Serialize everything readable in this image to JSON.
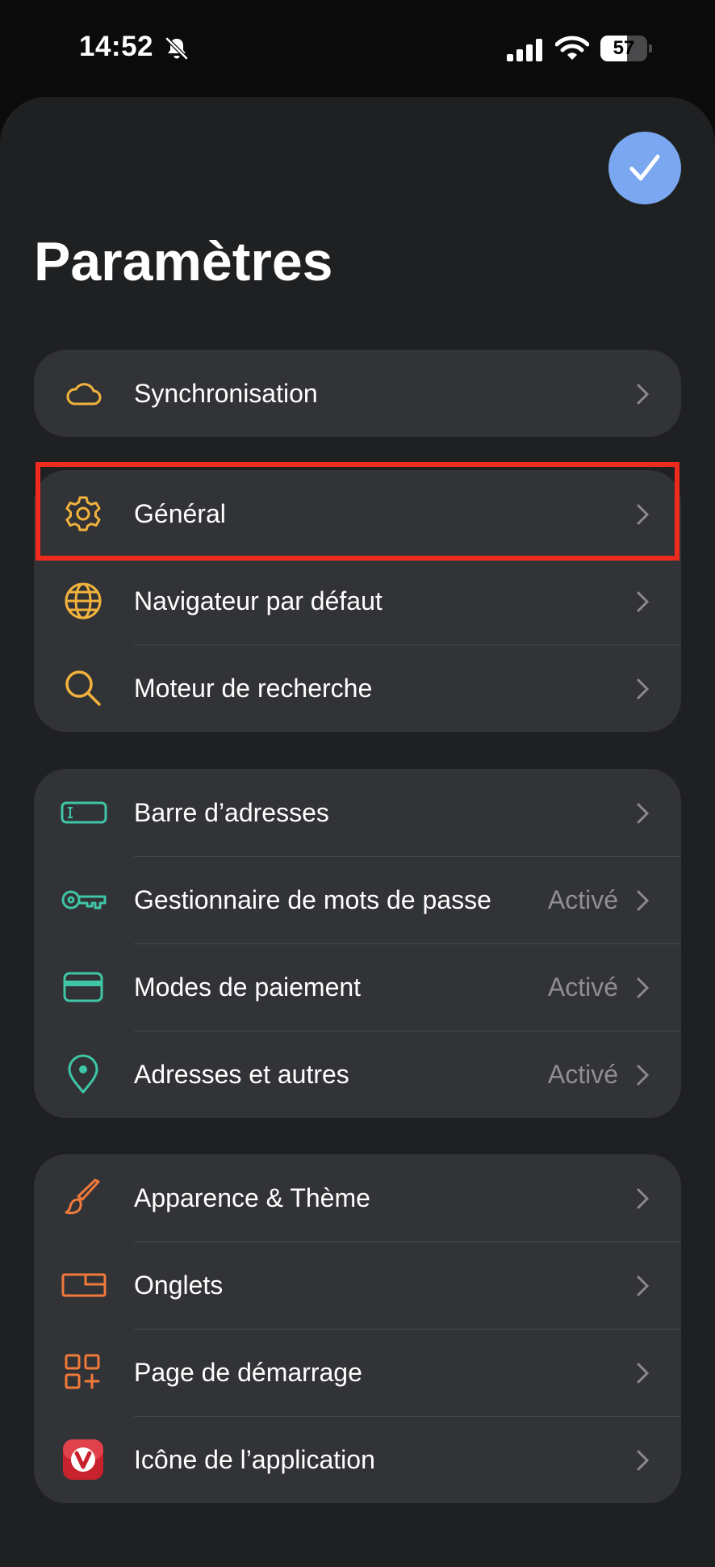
{
  "status_bar": {
    "time": "14:52",
    "battery": "57",
    "battery_level": 0.57
  },
  "header": {
    "title": "Paramètres"
  },
  "colors": {
    "yellow": "#f2b33d",
    "green": "#3fc6a6",
    "orange": "#f07a3a",
    "accent": "#7aa7f0",
    "highlight": "#ee2b1c"
  },
  "groups": [
    {
      "items": [
        {
          "label": "Synchronisation",
          "icon": "cloud-icon"
        }
      ]
    },
    {
      "items": [
        {
          "label": "Général",
          "icon": "gear-icon"
        },
        {
          "label": "Navigateur par défaut",
          "icon": "globe-icon"
        },
        {
          "label": "Moteur de recherche",
          "icon": "search-icon"
        }
      ]
    },
    {
      "items": [
        {
          "label": "Barre d’adresses",
          "icon": "address-bar-icon"
        },
        {
          "label": "Gestionnaire de mots de passe",
          "value": "Activé",
          "icon": "key-icon"
        },
        {
          "label": "Modes de paiement",
          "value": "Activé",
          "icon": "credit-card-icon"
        },
        {
          "label": "Adresses et autres",
          "value": "Activé",
          "icon": "location-pin-icon"
        }
      ]
    },
    {
      "items": [
        {
          "label": "Apparence & Thème",
          "icon": "paintbrush-icon"
        },
        {
          "label": "Onglets",
          "icon": "tabs-icon"
        },
        {
          "label": "Page de démarrage",
          "icon": "start-page-icon"
        },
        {
          "label": "Icône de l’application",
          "icon": "vivaldi-app-icon"
        }
      ]
    }
  ]
}
